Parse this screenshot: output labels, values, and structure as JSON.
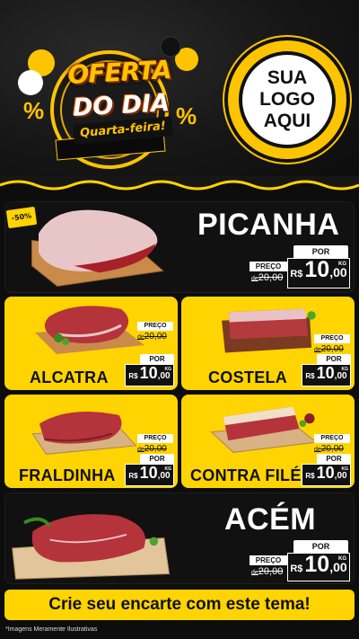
{
  "header": {
    "offer_title": "OFERTA",
    "offer_subtitle": "DO DIA",
    "offer_day": "Quarta-feira!",
    "logo_line1": "SUA",
    "logo_line2": "LOGO",
    "logo_line3": "AQUI",
    "accent_color": "#ffc400"
  },
  "discount_badge": "-50%",
  "products": [
    {
      "name": "PICANHA",
      "preco_label": "PREÇO",
      "old_price": "20,00",
      "de": "de",
      "por_label": "POR",
      "currency": "R$",
      "price_int": "10",
      "price_dec": ",00",
      "unit": "KG"
    },
    {
      "name": "ALCATRA",
      "preco_label": "PREÇO",
      "old_price": "20,00",
      "de": "de",
      "por_label": "POR",
      "currency": "R$",
      "price_int": "10",
      "price_dec": ",00",
      "unit": "KG"
    },
    {
      "name": "COSTELA",
      "preco_label": "PREÇO",
      "old_price": "20,00",
      "de": "de",
      "por_label": "POR",
      "currency": "R$",
      "price_int": "10",
      "price_dec": ",00",
      "unit": "KG"
    },
    {
      "name": "FRALDINHA",
      "preco_label": "PREÇO",
      "old_price": "20,00",
      "de": "de",
      "por_label": "POR",
      "currency": "R$",
      "price_int": "10",
      "price_dec": ",00",
      "unit": "KG"
    },
    {
      "name": "CONTRA FILÉ",
      "preco_label": "PREÇO",
      "old_price": "20,00",
      "de": "de",
      "por_label": "POR",
      "currency": "R$",
      "price_int": "10",
      "price_dec": ",00",
      "unit": "KG"
    },
    {
      "name": "ACÉM",
      "preco_label": "PREÇO",
      "old_price": "20,00",
      "de": "de",
      "por_label": "POR",
      "currency": "R$",
      "price_int": "10",
      "price_dec": ",00",
      "unit": "KG"
    }
  ],
  "cta": "Crie seu encarte com este tema!",
  "disclaimer": "*Imagens Meramente Ilustrativas",
  "colors": {
    "yellow": "#ffd400",
    "dark": "#111111",
    "meat": "#b5333b"
  }
}
